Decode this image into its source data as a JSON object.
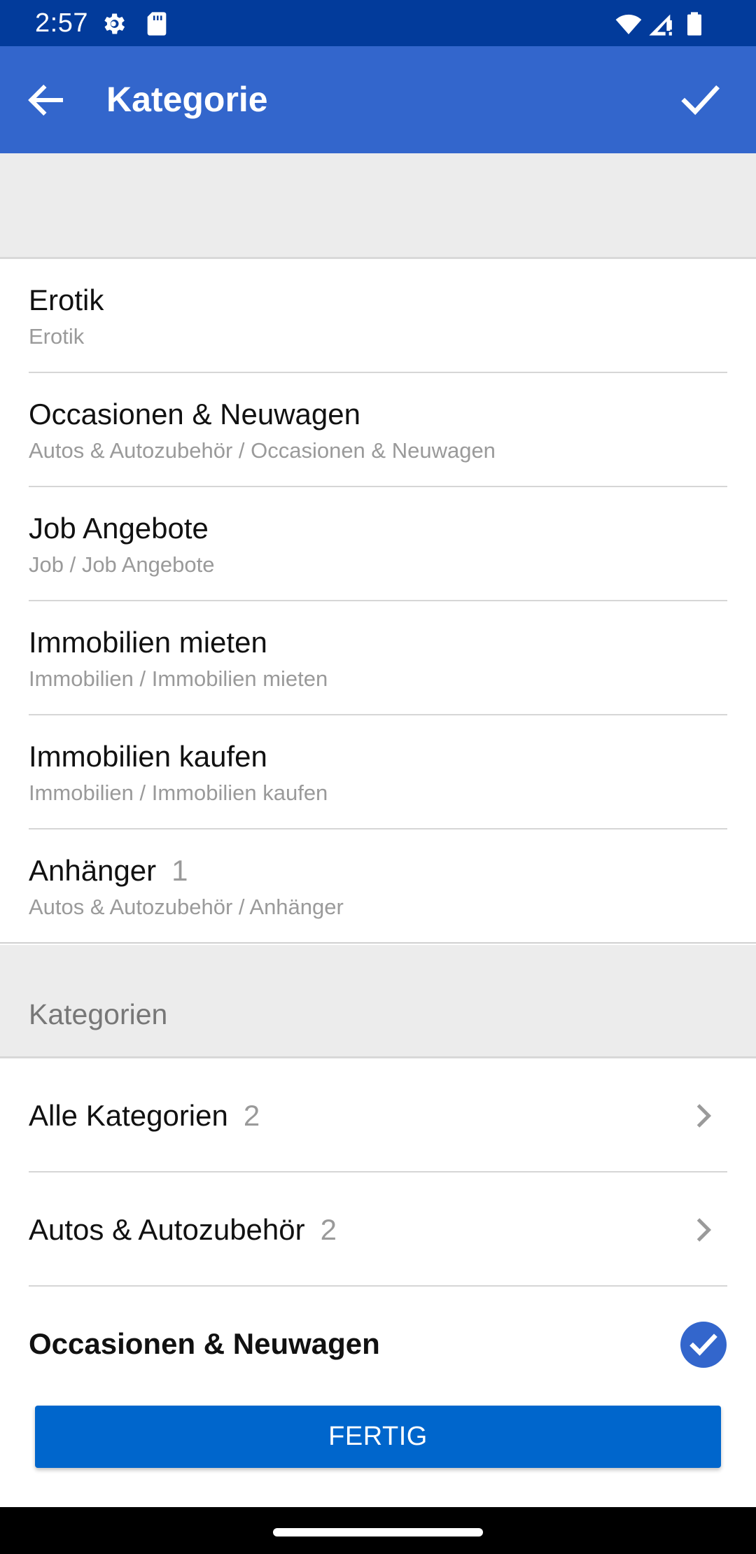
{
  "status_bar": {
    "time": "2:57",
    "icons": [
      "settings-icon",
      "sd-card-icon",
      "wifi-icon",
      "signal-icon",
      "battery-icon"
    ],
    "background": "#023b9b"
  },
  "app_bar": {
    "title": "Kategorie",
    "back_icon": "arrow-back-icon",
    "confirm_icon": "check-icon",
    "background": "#3366cc"
  },
  "recent": {
    "items": [
      {
        "title": "Erotik",
        "count": "",
        "subtitle": "Erotik"
      },
      {
        "title": "Occasionen & Neuwagen",
        "count": "",
        "subtitle": "Autos & Autozubehör / Occasionen & Neuwagen"
      },
      {
        "title": "Job Angebote",
        "count": "",
        "subtitle": "Job / Job Angebote"
      },
      {
        "title": "Immobilien mieten",
        "count": "",
        "subtitle": "Immobilien / Immobilien mieten"
      },
      {
        "title": "Immobilien kaufen",
        "count": "",
        "subtitle": "Immobilien / Immobilien kaufen"
      },
      {
        "title": "Anhänger",
        "count": "1",
        "subtitle": "Autos & Autozubehör / Anhänger"
      }
    ]
  },
  "categories": {
    "header": "Kategorien",
    "items": [
      {
        "label": "Alle Kategorien",
        "count": "2",
        "icon": "chevron-right-icon"
      },
      {
        "label": "Autos & Autozubehör",
        "count": "2",
        "icon": "chevron-right-icon"
      },
      {
        "label": "Occasionen & Neuwagen",
        "count": "",
        "icon": "check-circle-icon",
        "selected": true
      }
    ]
  },
  "footer": {
    "button_label": "FERTIG",
    "button_color": "#0066cc"
  },
  "colors": {
    "accent": "#3366cc",
    "secondary_text": "#9a9a9a",
    "section_background": "#ececec"
  }
}
